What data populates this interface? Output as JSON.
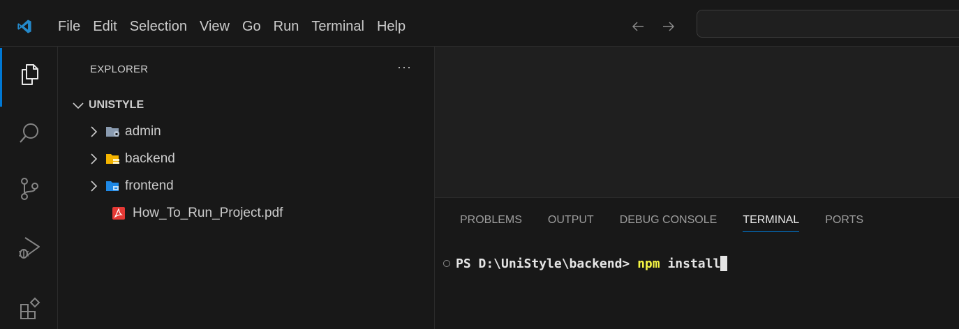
{
  "menubar": {
    "items": [
      "File",
      "Edit",
      "Selection",
      "View",
      "Go",
      "Run",
      "Terminal",
      "Help"
    ]
  },
  "sidebar": {
    "title": "EXPLORER",
    "more_label": "···",
    "root": "UNISTYLE",
    "items": [
      {
        "label": "admin",
        "type": "folder",
        "icon": "admin-folder-icon"
      },
      {
        "label": "backend",
        "type": "folder",
        "icon": "backend-folder-icon"
      },
      {
        "label": "frontend",
        "type": "folder",
        "icon": "frontend-folder-icon"
      },
      {
        "label": "How_To_Run_Project.pdf",
        "type": "file",
        "icon": "pdf-file-icon"
      }
    ]
  },
  "panel": {
    "tabs": [
      "PROBLEMS",
      "OUTPUT",
      "DEBUG CONSOLE",
      "TERMINAL",
      "PORTS"
    ],
    "active_tab": "TERMINAL"
  },
  "terminal": {
    "prompt": "PS D:\\UniStyle\\backend> ",
    "command": "npm",
    "args": " install"
  },
  "colors": {
    "accent": "#0078d4",
    "logo": "#2489ca",
    "pdf": "#e53935",
    "folder_backend": "#f4b400",
    "folder_frontend": "#1e88e5",
    "folder_admin": "#8a9bb0",
    "terminal_command": "#f5f543"
  }
}
